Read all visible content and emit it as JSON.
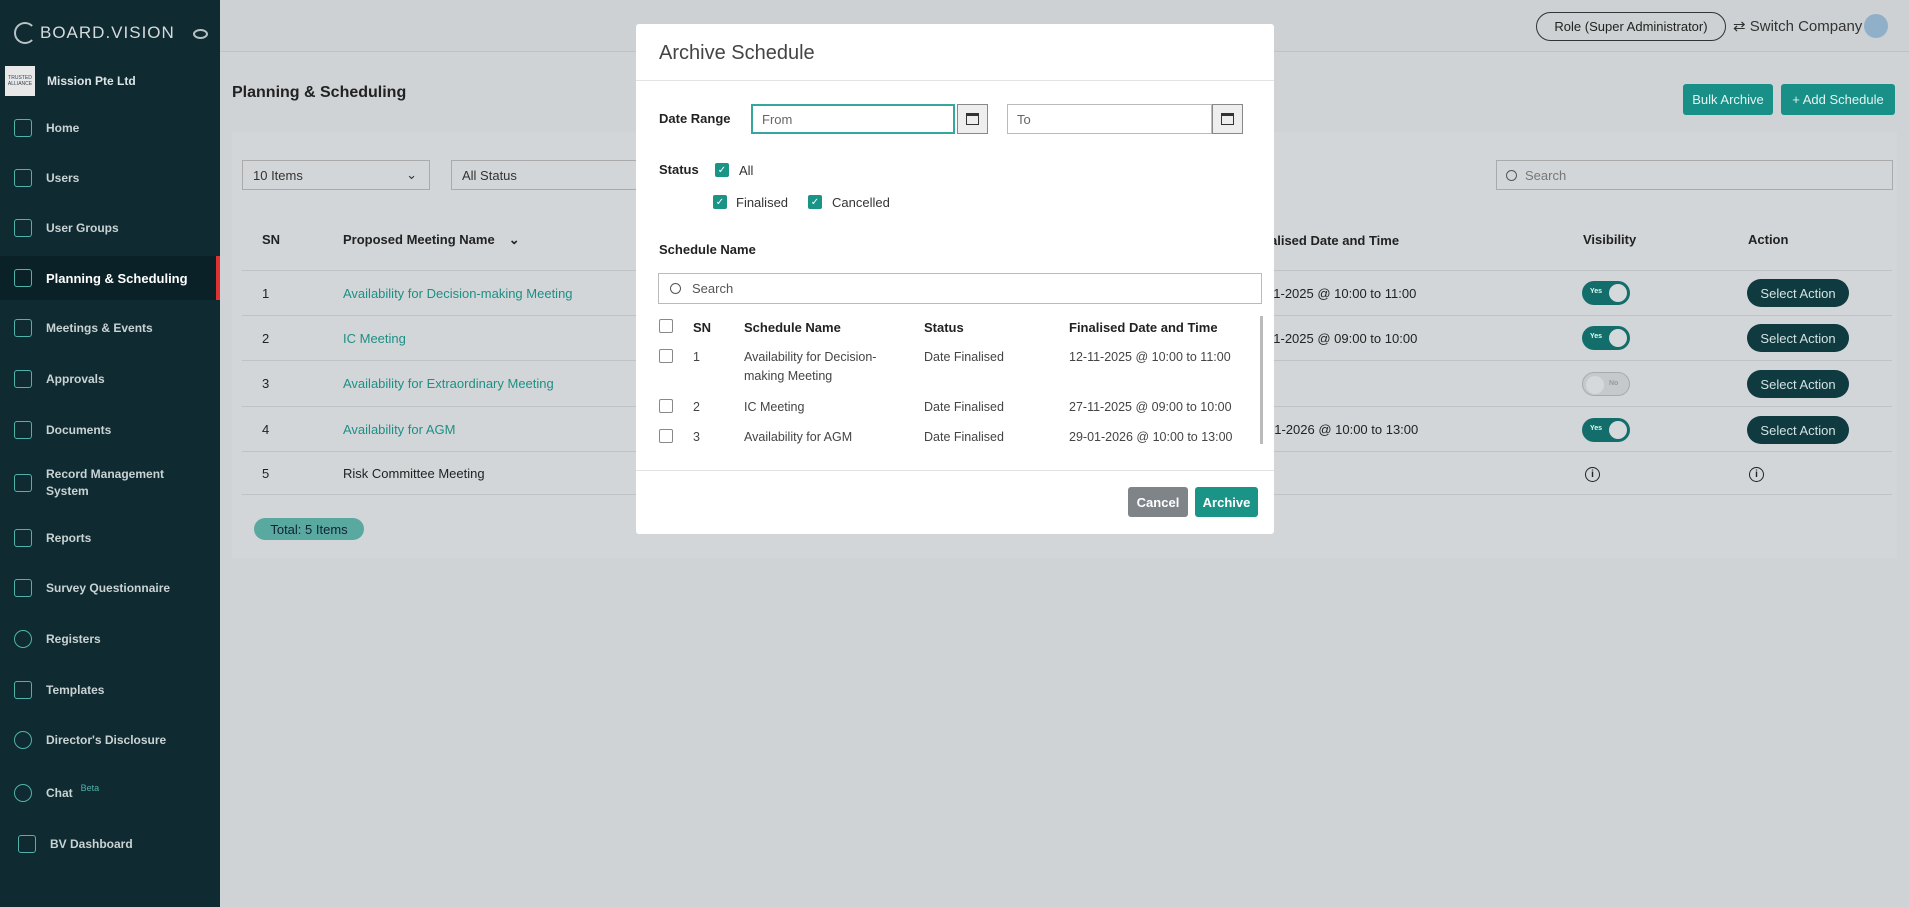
{
  "sidebar": {
    "logo_text": "BOARD.VISION",
    "company_logo_text": "TRUSTED ALLIANCE",
    "company_name": "Mission Pte Ltd",
    "items": [
      {
        "label": "Home",
        "icon": "home-icon"
      },
      {
        "label": "Users",
        "icon": "user-icon"
      },
      {
        "label": "User Groups",
        "icon": "users-icon"
      },
      {
        "label": "Planning & Scheduling",
        "icon": "bar-chart-icon"
      },
      {
        "label": "Meetings & Events",
        "icon": "calendar-icon"
      },
      {
        "label": "Approvals",
        "icon": "document-icon"
      },
      {
        "label": "Documents",
        "icon": "files-icon"
      },
      {
        "label": "Record Management System",
        "icon": "records-icon"
      },
      {
        "label": "Reports",
        "icon": "report-icon"
      },
      {
        "label": "Survey Questionnaire",
        "icon": "survey-icon"
      },
      {
        "label": "Registers",
        "icon": "registers-icon"
      },
      {
        "label": "Templates",
        "icon": "templates-icon"
      },
      {
        "label": "Director's Disclosure",
        "icon": "disclosure-icon"
      },
      {
        "label": "Chat",
        "icon": "chat-icon",
        "badge": "Beta"
      },
      {
        "label": "BV Dashboard",
        "icon": "dashboard-icon"
      }
    ]
  },
  "header": {
    "role": "Role (Super Administrator)",
    "switch_company": "Switch Company"
  },
  "page": {
    "title": "Planning & Scheduling",
    "bulk_archive": "Bulk Archive",
    "add_schedule": "+ Add Schedule",
    "items_select": "10 Items",
    "status_select": "All Status",
    "search_placeholder": "Search",
    "total": "Total: 5 Items"
  },
  "table": {
    "headers": {
      "sn": "SN",
      "name": "Proposed Meeting Name",
      "finalised": "alised Date and Time",
      "visibility": "Visibility",
      "action": "Action"
    },
    "rows": [
      {
        "sn": "1",
        "name": "Availability for Decision-making Meeting",
        "finalised": "11-2025 @ 10:00 to 11:00",
        "visibility": "Yes",
        "action": "Select Action"
      },
      {
        "sn": "2",
        "name": "IC Meeting",
        "finalised": "11-2025 @ 09:00 to 10:00",
        "visibility": "Yes",
        "action": "Select Action"
      },
      {
        "sn": "3",
        "name": "Availability for Extraordinary Meeting",
        "finalised": "",
        "visibility": "No",
        "action": "Select Action"
      },
      {
        "sn": "4",
        "name": "Availability for AGM",
        "finalised": "01-2026 @ 10:00 to 13:00",
        "visibility": "Yes",
        "action": "Select Action"
      },
      {
        "sn": "5",
        "name": "Risk Committee Meeting",
        "finalised": "",
        "visibility": "i",
        "action": "i"
      }
    ]
  },
  "modal": {
    "title": "Archive Schedule",
    "date_range_label": "Date Range",
    "from_placeholder": "From",
    "to_placeholder": "To",
    "status_label": "Status",
    "status_all": "All",
    "status_finalised": "Finalised",
    "status_cancelled": "Cancelled",
    "schedule_name_label": "Schedule Name",
    "search_placeholder": "Search",
    "headers": {
      "sn": "SN",
      "name": "Schedule Name",
      "status": "Status",
      "finalised": "Finalised Date and Time"
    },
    "rows": [
      {
        "sn": "1",
        "name": "Availability for Decision-making Meeting",
        "status": "Date Finalised",
        "finalised": "12-11-2025 @ 10:00 to 11:00"
      },
      {
        "sn": "2",
        "name": "IC Meeting",
        "status": "Date Finalised",
        "finalised": "27-11-2025 @ 09:00 to 10:00"
      },
      {
        "sn": "3",
        "name": "Availability for AGM",
        "status": "Date Finalised",
        "finalised": "29-01-2026 @ 10:00 to 13:00"
      }
    ],
    "cancel": "Cancel",
    "archive": "Archive"
  },
  "colors": {
    "accent": "#1b9488",
    "sidebar": "#0f2a30",
    "danger": "#d33333"
  }
}
